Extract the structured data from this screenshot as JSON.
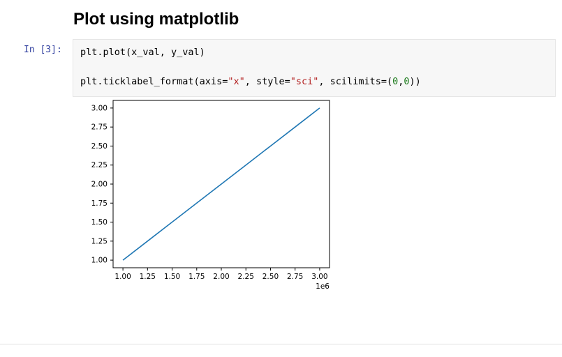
{
  "heading": "Plot using matplotlib",
  "cell": {
    "prompt": "In [3]:",
    "code_tokens": [
      {
        "t": "plt.plot(x_val, y_val)\n\nplt.ticklabel_format(axis"
      },
      {
        "t": "="
      },
      {
        "t": "\"x\"",
        "cls": "tok-s"
      },
      {
        "t": ", style"
      },
      {
        "t": "="
      },
      {
        "t": "\"sci\"",
        "cls": "tok-s"
      },
      {
        "t": ", scilimits"
      },
      {
        "t": "=("
      },
      {
        "t": "0",
        "cls": "tok-n"
      },
      {
        "t": ","
      },
      {
        "t": "0",
        "cls": "tok-n"
      },
      {
        "t": "))"
      }
    ]
  },
  "chart_data": {
    "type": "line",
    "series": [
      {
        "name": "",
        "x": [
          1.0,
          1.25,
          1.5,
          1.75,
          2.0,
          2.25,
          2.5,
          2.75,
          3.0
        ],
        "y": [
          1.0,
          1.25,
          1.5,
          1.75,
          2.0,
          2.25,
          2.5,
          2.75,
          3.0
        ]
      }
    ],
    "x_ticks": [
      "1.00",
      "1.25",
      "1.50",
      "1.75",
      "2.00",
      "2.25",
      "2.50",
      "2.75",
      "3.00"
    ],
    "y_ticks": [
      "1.00",
      "1.25",
      "1.50",
      "1.75",
      "2.00",
      "2.25",
      "2.50",
      "2.75",
      "3.00"
    ],
    "x_offset_text": "1e6",
    "xlim": [
      1.0,
      3.0
    ],
    "ylim": [
      1.0,
      3.0
    ],
    "title": "",
    "xlabel": "",
    "ylabel": ""
  }
}
